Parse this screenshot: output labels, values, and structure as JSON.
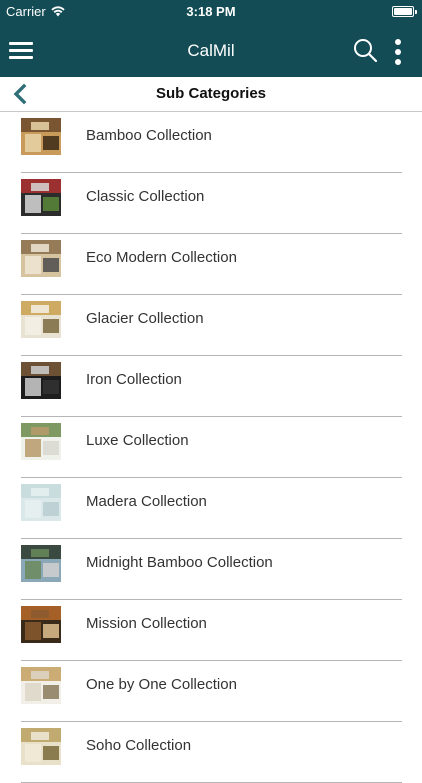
{
  "status_bar": {
    "carrier": "Carrier",
    "time": "3:18 PM"
  },
  "nav": {
    "title": "CalMil",
    "menu_icon": "hamburger-icon",
    "search_icon": "search-icon",
    "more_icon": "more-vertical-icon"
  },
  "sub_header": {
    "title": "Sub Categories",
    "back_icon": "chevron-left-icon"
  },
  "colors": {
    "nav_bg": "#134c55",
    "accent": "#2f6e78",
    "divider": "#b5b5b5"
  },
  "categories": [
    {
      "label": "Bamboo Collection"
    },
    {
      "label": "Classic Collection"
    },
    {
      "label": "Eco Modern Collection"
    },
    {
      "label": "Glacier Collection"
    },
    {
      "label": "Iron Collection"
    },
    {
      "label": "Luxe Collection"
    },
    {
      "label": "Madera Collection"
    },
    {
      "label": "Midnight Bamboo Collection"
    },
    {
      "label": "Mission Collection"
    },
    {
      "label": "One by One Collection"
    },
    {
      "label": "Soho Collection"
    }
  ]
}
